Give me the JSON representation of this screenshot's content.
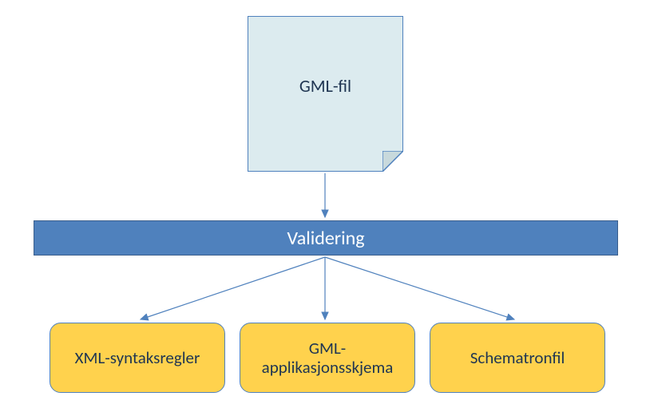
{
  "chart_data": {
    "type": "diagram",
    "nodes": [
      {
        "id": "gml_file",
        "label": "GML-fil",
        "shape": "document",
        "fill": "#dcebef"
      },
      {
        "id": "validering",
        "label": "Validering",
        "shape": "rect",
        "fill": "#4f81bd",
        "text_color": "#ffffff"
      },
      {
        "id": "xml_syntax",
        "label": "XML-syntaksregler",
        "shape": "rounded-rect",
        "fill": "#ffd24d"
      },
      {
        "id": "gml_appschema",
        "label": "GML-applikasjonsskjema",
        "shape": "rounded-rect",
        "fill": "#ffd24d"
      },
      {
        "id": "schematron",
        "label": "Schematronfil",
        "shape": "rounded-rect",
        "fill": "#ffd24d"
      }
    ],
    "edges": [
      {
        "from": "gml_file",
        "to": "validering"
      },
      {
        "from": "validering",
        "to": "xml_syntax"
      },
      {
        "from": "validering",
        "to": "gml_appschema"
      },
      {
        "from": "validering",
        "to": "schematron"
      }
    ]
  },
  "doc": {
    "label": "GML-fil"
  },
  "bar": {
    "label": "Validering"
  },
  "boxes": {
    "b1": "XML-syntaksregler",
    "b2": "GML-applikasjonsskjema",
    "b3": "Schematronfil"
  },
  "colors": {
    "doc_fill": "#dcebef",
    "bar_fill": "#4f81bd",
    "box_fill": "#ffd24d",
    "stroke": "#4f81bd",
    "arrow": "#4f81bd"
  }
}
